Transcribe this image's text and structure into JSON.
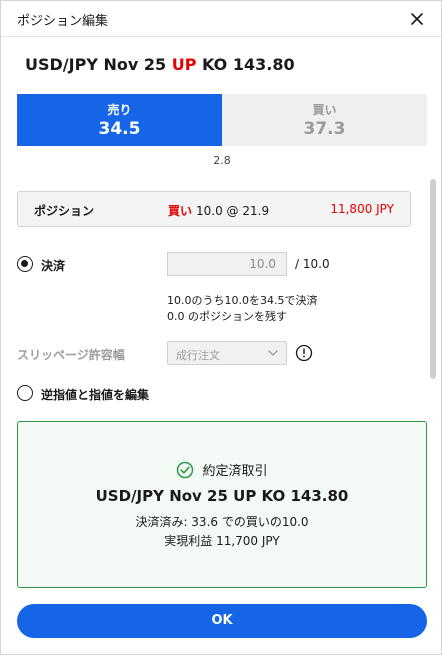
{
  "header": {
    "title": "ポジション編集",
    "close_icon": "close-icon"
  },
  "instrument": {
    "prefix": "USD/JPY Nov 25 ",
    "direction": "UP",
    "suffix": " KO 143.80",
    "direction_color": "#e60000"
  },
  "prices": {
    "sell_label": "売り",
    "sell_value": "34.5",
    "buy_label": "買い",
    "buy_value": "37.3",
    "spread": "2.8",
    "sell_color": "#1565e6"
  },
  "position": {
    "label": "ポジション",
    "side": "買い",
    "detail": "10.0 @ 21.9",
    "pnl": "11,800 JPY"
  },
  "settle": {
    "label": "決済",
    "selected": true,
    "quantity_value": "10.0",
    "quantity_max": "/ 10.0",
    "info_line1": "10.0のうち10.0を34.5で決済",
    "info_line2": "0.0 のポジションを残す"
  },
  "slippage": {
    "label": "スリッページ許容幅",
    "selected_option": "成行注文",
    "info_icon": "info-icon"
  },
  "stop_limit": {
    "label": "逆指値と指値を編集",
    "selected": false
  },
  "confirmation": {
    "title": "約定済取引",
    "icon": "check-circle-icon",
    "instrument": "USD/JPY Nov 25 UP KO 143.80",
    "line1": "決済済み: 33.6 での買いの10.0",
    "line2": "実現利益 11,700 JPY",
    "accent_color": "#2a9a47"
  },
  "ok_button": {
    "label": "OK",
    "color": "#1565e6"
  }
}
